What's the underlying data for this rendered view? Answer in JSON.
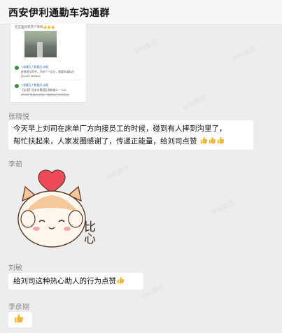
{
  "header": {
    "title": "西安伊利通勤车沟通群"
  },
  "watermark_text": "伊利集团",
  "card": {
    "caption": "在这里找到开户单机👍👍👍",
    "lines": [
      {
        "kind": "name",
        "text": "T-收藏万人数据员-冰檀"
      },
      {
        "kind": "text",
        "text": "进餐提示声中，只听个一区分，需要的请私信"
      },
      {
        "kind": "text",
        "text": "比1007463620"
      },
      {
        "kind": "name",
        "text": "T-收藏万人数据员-冰檀"
      },
      {
        "kind": "text",
        "text": "【出租】西安市雁塔区高新路6-一702-"
      },
      {
        "kind": "strike",
        "text": "29/00   发展电信局，通常用在车员发送"
      }
    ]
  },
  "messages": [
    {
      "sender": "张晓悦",
      "text": "今天早上刘司在床单厂方向接员工的时候，碰到有人摔到沟里了，",
      "text2": "帮忙扶起来，人家发圈感谢了，传递正能量，给刘司点赞",
      "emoji_count": 3
    },
    {
      "sender": "李茹",
      "sticker": "cat-heart-bixin",
      "sticker_text": "比心"
    },
    {
      "sender": "刘敏",
      "text": "给刘司这种热心助人的行为点赞",
      "emoji_count": 1
    },
    {
      "sender": "李彦刚",
      "emoji_count": 1
    }
  ],
  "colors": {
    "background": "#ededed",
    "bubble": "#ffffff",
    "name": "#888888",
    "heart": "#ee4b5a",
    "thumb": "#f2b632"
  }
}
